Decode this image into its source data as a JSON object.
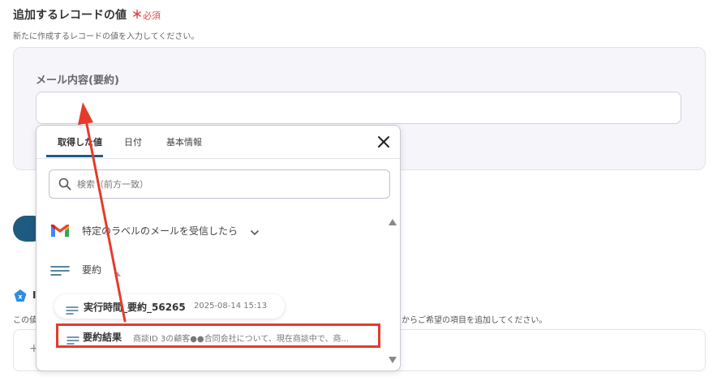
{
  "section": {
    "title": "追加するレコードの値",
    "required_mark": "＊",
    "required_text": "必須",
    "description": "新たに作成するレコードの値を入力してください。"
  },
  "field": {
    "label": "メール内容(要約)",
    "value": ""
  },
  "background": {
    "icon_letter": "x",
    "label_char": "I",
    "desc_left": "この値",
    "desc_right": "からご希望の項目を追加してください。",
    "plus": "+"
  },
  "popup": {
    "tabs": [
      {
        "label": "取得した値",
        "active": true
      },
      {
        "label": "日付",
        "active": false
      },
      {
        "label": "基本情報",
        "active": false
      }
    ],
    "search_placeholder": "検索（前方一致）",
    "group": {
      "label": "特定のラベルのメールを受信したら"
    },
    "summary": {
      "label": "要約"
    },
    "chip": {
      "title": "実行時間_要約_56265",
      "meta": "2025-08-14 15:13"
    },
    "result": {
      "title": "要約結果",
      "value": "商談ID 3の顧客●●合同会社について、現在商談中で、商..."
    }
  },
  "colors": {
    "accent": "#1f5b80",
    "highlight": "#e53a2c",
    "required": "#e04a4a"
  }
}
